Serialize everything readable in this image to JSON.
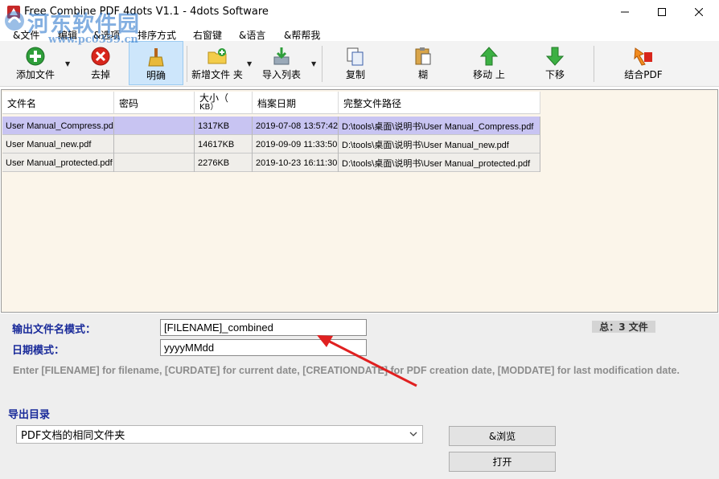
{
  "window": {
    "title": "Free Combine PDF 4dots V1.1 - 4dots Software"
  },
  "menu": {
    "items": [
      "&文件",
      "编辑",
      "&选项",
      "排序方式",
      "右窗键",
      "&语言",
      "&帮帮我"
    ]
  },
  "watermark": {
    "text": "河东软件园",
    "url": "www.pc0359.cn"
  },
  "toolbar": {
    "add_file": "添加文件",
    "remove": "去掉",
    "clear": "明确",
    "new_folder": "新增文件 夹",
    "import_list": "导入列表",
    "copy": "复制",
    "paste": "糊",
    "move_up": "移动 上",
    "move_down": "下移",
    "combine_pdf": "结合PDF"
  },
  "grid": {
    "columns": [
      "文件名",
      "密码",
      "大小（",
      "KB）",
      "档案日期",
      "完整文件路径"
    ],
    "rows": [
      {
        "filename": "User Manual_Compress.pdf",
        "password": "",
        "size": "1317KB",
        "date": "2019-07-08 13:57:42",
        "path": "D:\\tools\\桌面\\说明书\\User Manual_Compress.pdf"
      },
      {
        "filename": "User Manual_new.pdf",
        "password": "",
        "size": "14617KB",
        "date": "2019-09-09 11:33:50",
        "path": "D:\\tools\\桌面\\说明书\\User Manual_new.pdf"
      },
      {
        "filename": "User Manual_protected.pdf",
        "password": "",
        "size": "2276KB",
        "date": "2019-10-23 16:11:30",
        "path": "D:\\tools\\桌面\\说明书\\User Manual_protected.pdf"
      }
    ]
  },
  "options": {
    "output_pattern_label": "输出文件名模式：",
    "output_pattern_value": "[FILENAME]_combined",
    "date_pattern_label": "日期模式：",
    "date_pattern_value": "yyyyMMdd",
    "total": "总：3 文件",
    "help_text": "Enter [FILENAME] for filename, [CURDATE] for current date, [CREATIONDATE] for PDF creation date, [MODDATE] for last modification date.",
    "export_dir_label": "导出目录",
    "export_dir_value": "PDF文档的相同文件夹",
    "browse": "&浏览",
    "open": "打开"
  },
  "colors": {
    "accent_label": "#1a2b9a",
    "selected_row": "#c8c4f2",
    "annotation": "#e02020"
  }
}
